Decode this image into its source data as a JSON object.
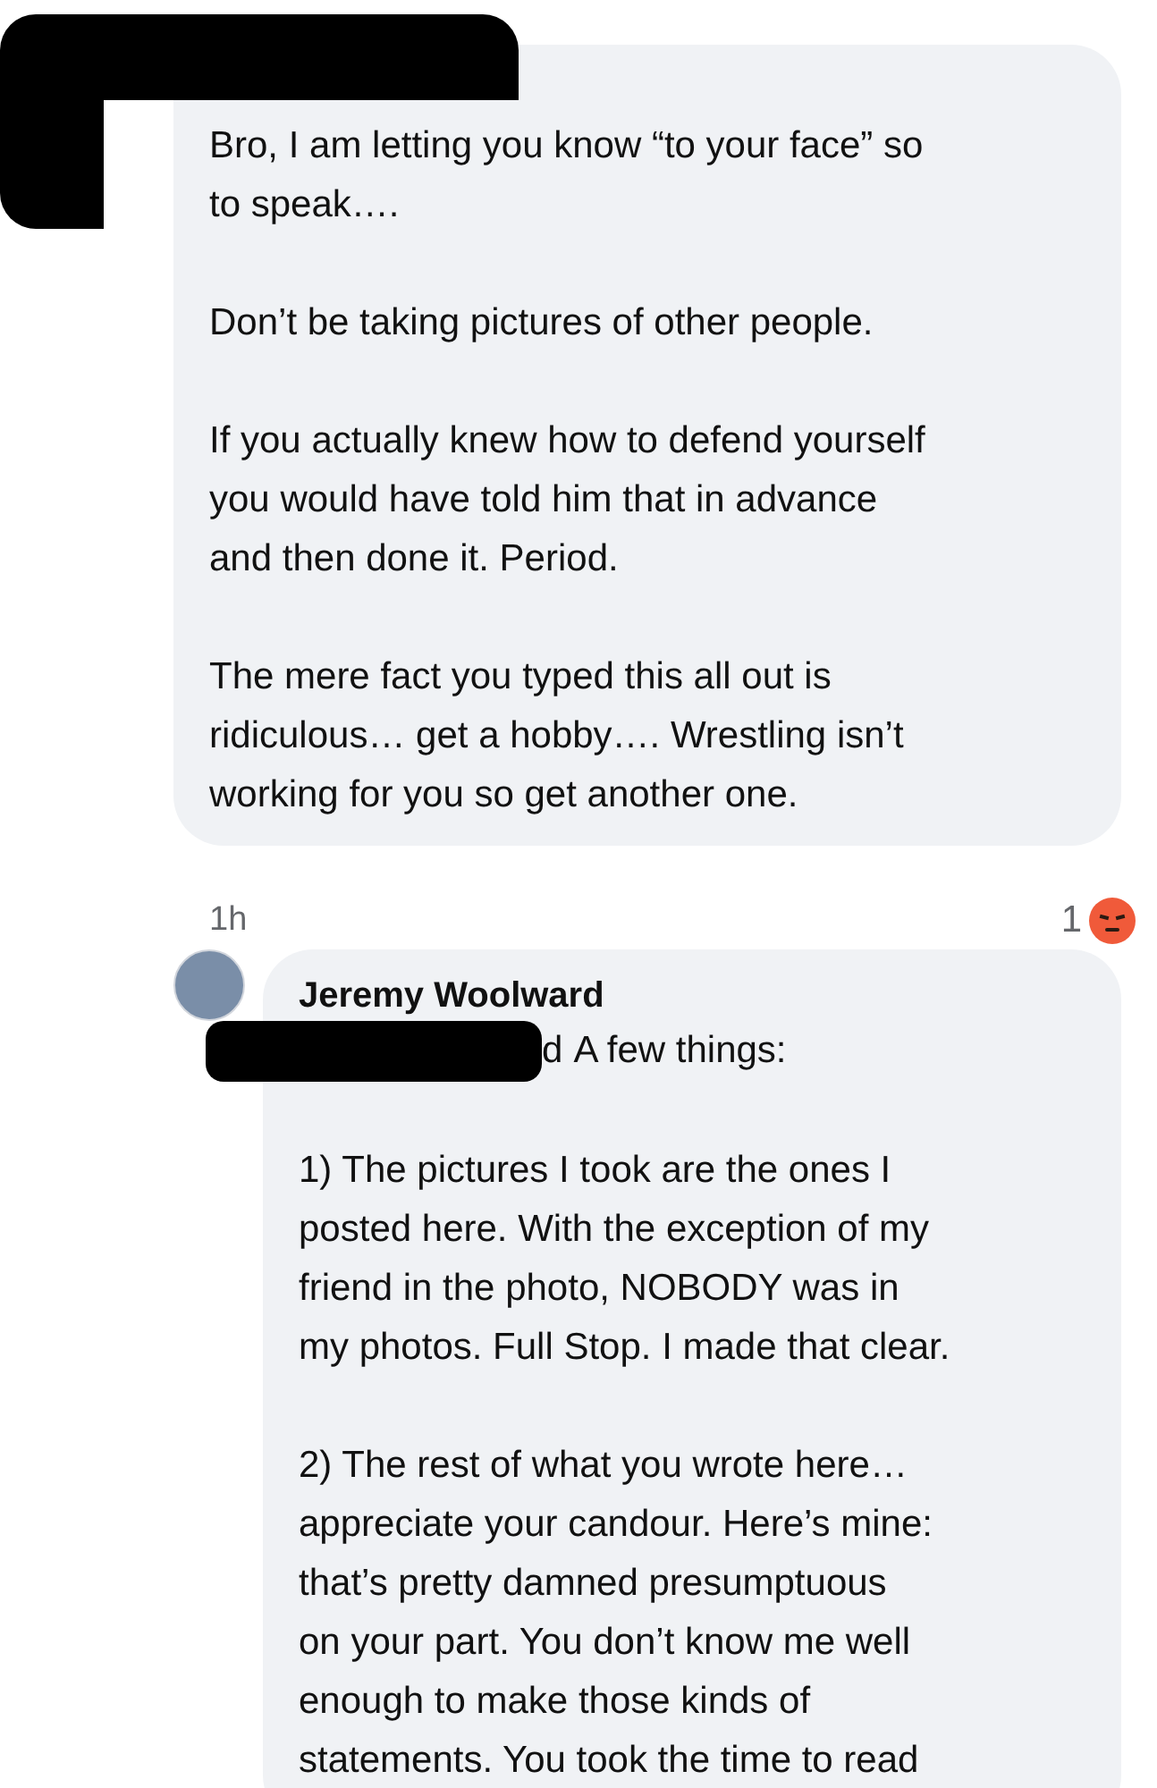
{
  "comments": [
    {
      "paragraphs": [
        [
          "Bro, I am letting you know “to your face” so",
          "to speak…."
        ],
        [
          "Don’t be taking pictures of other people."
        ],
        [
          "If you actually knew how to defend yourself",
          "you would have told him that in advance",
          "and then done it. Period."
        ],
        [
          "The mere fact you typed this all out is",
          "ridiculous… get a hobby…. Wrestling isn’t",
          "working for you so get another one."
        ]
      ],
      "time": "1h",
      "reaction_count": "1"
    },
    {
      "author": "Jeremy Woolward",
      "mention": "d",
      "paragraphs": [
        [
          "A few things:"
        ],
        [
          "1) The pictures I took are the ones I",
          "posted here. With the exception of my",
          "friend in the photo, NOBODY was in",
          "my photos. Full Stop. I made that clear."
        ],
        [
          "2) The rest of what you wrote here…",
          "appreciate your candour. Here’s mine:",
          "that’s pretty damned presumptuous",
          "on your part. You don’t know me well",
          "enough to make those kinds of",
          "statements. You took the time to read"
        ]
      ]
    }
  ]
}
